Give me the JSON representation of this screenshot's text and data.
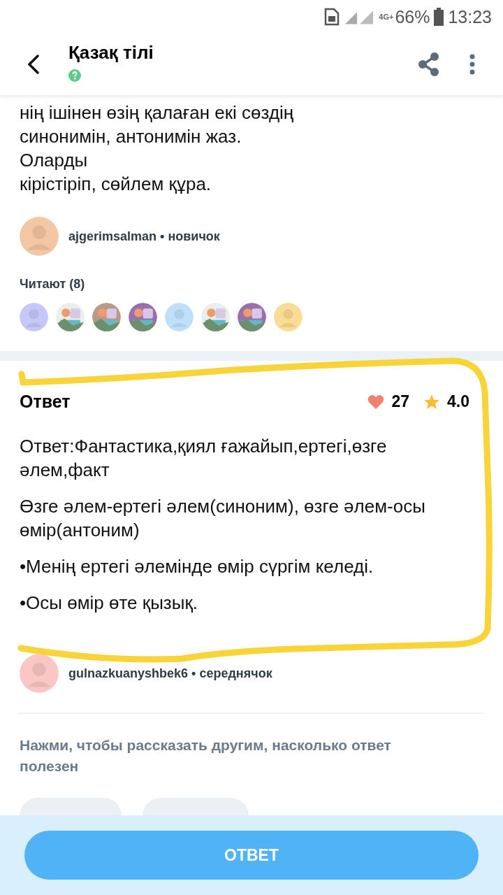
{
  "status_bar": {
    "network": "4G+",
    "battery": "66%",
    "time": "13:23"
  },
  "header": {
    "title": "Қазақ тілі"
  },
  "question": {
    "lines": [
      "нің ішінен өзің қалаған екі сөздің",
      "синонимін, антонимін жаз.",
      "Оларды",
      "кірістіріп, сөйлем құра."
    ],
    "author": {
      "name": "ajgerimsalman",
      "separator": "•",
      "rank": "новичок"
    }
  },
  "readers": {
    "label": "Читают (8)",
    "avatars": [
      {
        "kind": "avatar",
        "color": "#c5c8f7"
      },
      {
        "kind": "picture",
        "color": "#e8f0ee"
      },
      {
        "kind": "picture",
        "color": "#b89a88"
      },
      {
        "kind": "picture",
        "color": "#9a6fb0"
      },
      {
        "kind": "avatar",
        "color": "#bfe0fb"
      },
      {
        "kind": "picture",
        "color": "#e6efec"
      },
      {
        "kind": "picture",
        "color": "#9a6fb0"
      },
      {
        "kind": "avatar",
        "color": "#fbdc94"
      }
    ]
  },
  "answer": {
    "heading": "Ответ",
    "likes": "27",
    "rating": "4.0",
    "paragraphs": [
      "Ответ:Фантастика,қиял ғажайып,ертегі,өзге әлем,факт",
      "Өзге әлем-ертегі әлем(синоним), өзге әлем-осы өмір(антоним)",
      "•Менің ертегі әлемінде өмір сүргім келеді.",
      "•Осы өмір өте қызық."
    ],
    "author": {
      "name": "gulnazkuanyshbek6",
      "separator": "•",
      "rank": "середнячок"
    },
    "hint": "Нажми, чтобы рассказать другим, насколько ответ полезен"
  },
  "answer_button": "ОТВЕТ"
}
